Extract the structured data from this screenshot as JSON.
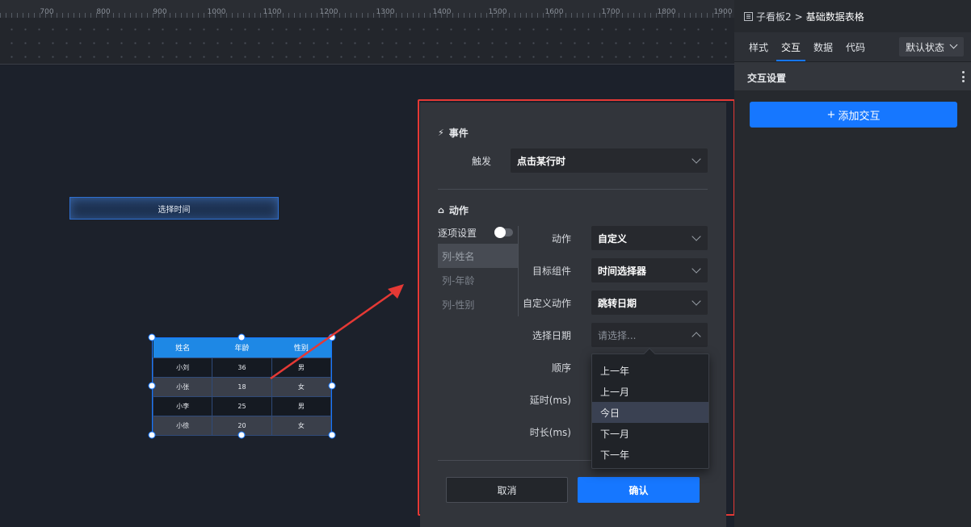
{
  "ruler": {
    "labels": [
      "700",
      "800",
      "900",
      "1000",
      "1100",
      "1200",
      "1300",
      "1400",
      "1500",
      "1600",
      "1700",
      "1800",
      "1900"
    ]
  },
  "canvas": {
    "time_button_label": "选择时间",
    "table": {
      "headers": [
        "姓名",
        "年龄",
        "性别"
      ],
      "rows": [
        [
          "小刘",
          "36",
          "男"
        ],
        [
          "小张",
          "18",
          "女"
        ],
        [
          "小李",
          "25",
          "男"
        ],
        [
          "小徐",
          "20",
          "女"
        ]
      ]
    }
  },
  "modal": {
    "event_title": "事件",
    "trigger_label": "触发",
    "trigger_value": "点击某行时",
    "action_title": "动作",
    "per_item_label": "逐项设置",
    "items": [
      "列-姓名",
      "列-年龄",
      "列-性别"
    ],
    "fields": {
      "action_label": "动作",
      "action_value": "自定义",
      "target_label": "目标组件",
      "target_value": "时间选择器",
      "custom_action_label": "自定义动作",
      "custom_action_value": "跳转日期",
      "select_date_label": "选择日期",
      "select_date_placeholder": "请选择...",
      "order_label": "顺序",
      "delay_label": "延时(ms)",
      "duration_label": "时长(ms)"
    },
    "date_options": [
      "上一年",
      "上一月",
      "今日",
      "下一月",
      "下一年"
    ],
    "cancel_label": "取消",
    "ok_label": "确认"
  },
  "panel": {
    "breadcrumb": {
      "parent": "子看板2",
      "separator": ">",
      "current": "基础数据表格"
    },
    "tabs": [
      "样式",
      "交互",
      "数据",
      "代码"
    ],
    "active_tab": "交互",
    "state_select": "默认状态",
    "section_title": "交互设置",
    "add_button": "添加交互",
    "add_icon": "+"
  },
  "colors": {
    "accent": "#1677ff",
    "highlight": "#e53935"
  }
}
